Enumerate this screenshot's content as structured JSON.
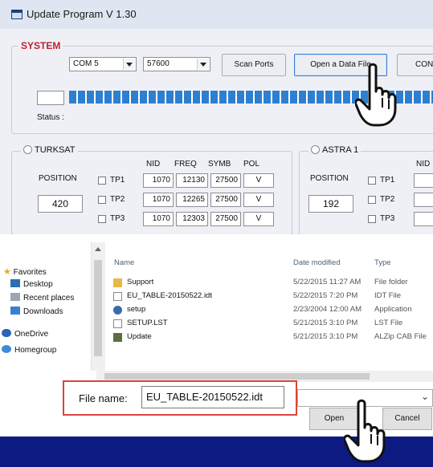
{
  "app": {
    "title": "Update Program V 1.30"
  },
  "system": {
    "legend": "SYSTEM",
    "com_port": "COM 5",
    "baud_rate": "57600",
    "scan_ports_label": "Scan Ports",
    "open_data_file_label": "Open a Data File",
    "connect_label_partial": "CON",
    "status_label": "Status :",
    "progress_fraction": 1.0
  },
  "turksat": {
    "name": "TURKSAT",
    "position_label": "POSITION",
    "position_value": "420",
    "columns": [
      "NID",
      "FREQ",
      "SYMB",
      "POL"
    ],
    "tps": [
      {
        "label": "TP1",
        "nid": "1070",
        "freq": "12130",
        "symb": "27500",
        "pol": "V"
      },
      {
        "label": "TP2",
        "nid": "1070",
        "freq": "12265",
        "symb": "27500",
        "pol": "V"
      },
      {
        "label": "TP3",
        "nid": "1070",
        "freq": "12303",
        "symb": "27500",
        "pol": "V"
      }
    ]
  },
  "astra": {
    "name": "ASTRA 1",
    "position_label": "POSITION",
    "position_value": "192",
    "nid_label": "NID",
    "tps": [
      {
        "label": "TP1"
      },
      {
        "label": "TP2"
      },
      {
        "label": "TP3"
      }
    ]
  },
  "dialog": {
    "nav": [
      {
        "label": "Favorites",
        "icon": "star-icon"
      },
      {
        "label": "Desktop",
        "icon": "desktop-icon"
      },
      {
        "label": "Recent places",
        "icon": "recent-places-icon"
      },
      {
        "label": "Downloads",
        "icon": "downloads-icon"
      },
      {
        "label": "OneDrive",
        "icon": "cloud-icon"
      },
      {
        "label": "Homegroup",
        "icon": "homegroup-icon"
      }
    ],
    "headers": {
      "name": "Name",
      "date": "Date modified",
      "type": "Type"
    },
    "files": [
      {
        "name": "Support",
        "date": "5/22/2015 11:27 AM",
        "type": "File folder",
        "icon": "folder-icon"
      },
      {
        "name": "EU_TABLE-20150522.idt",
        "date": "5/22/2015 7:20 PM",
        "type": "IDT File",
        "icon": "file-icon"
      },
      {
        "name": "setup",
        "date": "2/23/2004 12:00 AM",
        "type": "Application",
        "icon": "setup-icon"
      },
      {
        "name": "SETUP.LST",
        "date": "5/21/2015 3:10 PM",
        "type": "LST File",
        "icon": "file-icon"
      },
      {
        "name": "Update",
        "date": "5/21/2015 3:10 PM",
        "type": "ALZip CAB File",
        "icon": "cab-icon"
      }
    ],
    "filename_label": "File name:",
    "filename_value": "EU_TABLE-20150522.idt",
    "open_label": "Open",
    "cancel_label": "Cancel"
  },
  "colors": {
    "system_legend": "#c3202c",
    "progress": "#2e7fd0",
    "highlight_box": "#d9453b",
    "taskbar": "#0d1a82"
  }
}
